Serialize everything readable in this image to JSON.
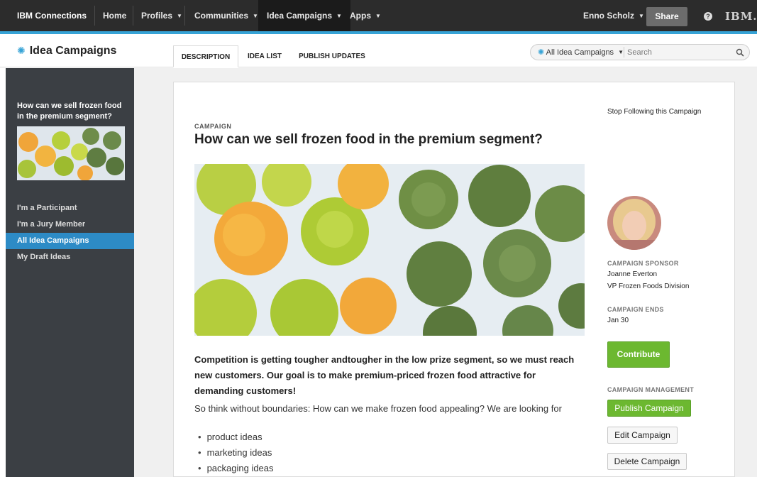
{
  "topnav": {
    "brand": "IBM Connections",
    "home": "Home",
    "profiles": "Profiles",
    "communities": "Communities",
    "idea_campaigns": "Idea Campaigns",
    "apps": "Apps",
    "user": "Enno Scholz",
    "share": "Share",
    "help": "?",
    "logo_text": "IBM."
  },
  "header": {
    "app_title": "Idea Campaigns",
    "tabs": [
      {
        "label": "DESCRIPTION",
        "selected": true
      },
      {
        "label": "IDEA LIST",
        "selected": false
      },
      {
        "label": "PUBLISH UPDATES",
        "selected": false
      }
    ],
    "search": {
      "scope": "All Idea Campaigns",
      "placeholder": "Search"
    }
  },
  "sidebar": {
    "campaign_title": "How can we sell frozen food in the premium segment?",
    "nav": [
      {
        "label": "I'm a Participant",
        "active": false
      },
      {
        "label": "I'm a Jury Member",
        "active": false
      },
      {
        "label": "All Idea Campaigns",
        "active": true
      },
      {
        "label": "My Draft Ideas",
        "active": false
      }
    ]
  },
  "campaign": {
    "kicker": "CAMPAIGN",
    "title": "How can we sell frozen food in the premium segment?",
    "lead": "Competition is getting tougher andtougher in the low prize segment, so we must reach new customers. Our goal is to make premium-priced frozen food attractive for demanding customers!",
    "body": "So think without boundaries: How can we make frozen food appealing? We are looking for",
    "ideas": [
      "product ideas",
      "marketing ideas",
      "packaging ideas"
    ]
  },
  "aside": {
    "follow": "Stop Following this Campaign",
    "sponsor_label": "CAMPAIGN SPONSOR",
    "sponsor_name": "Joanne Everton",
    "sponsor_role": "VP Frozen Foods Division",
    "ends_label": "CAMPAIGN ENDS",
    "ends_value": "Jan 30",
    "contribute": "Contribute",
    "management_label": "CAMPAIGN MANAGEMENT",
    "publish": "Publish Campaign",
    "edit": "Edit Campaign",
    "delete": "Delete Campaign"
  },
  "colors": {
    "nav_bg": "#2c2c2c",
    "accent_blue": "#36a3d6",
    "sidebar_bg": "#3b3f44",
    "active_nav": "#2d8bc6",
    "green": "#6cb830"
  }
}
